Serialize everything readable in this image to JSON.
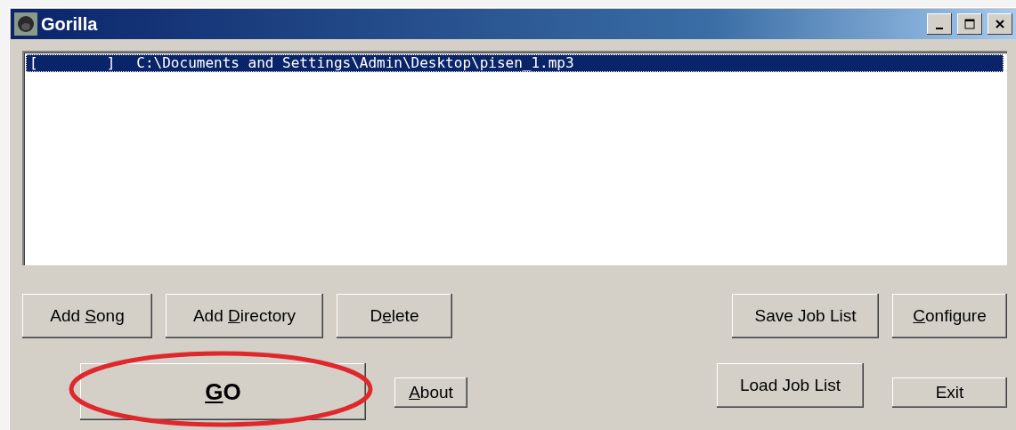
{
  "window": {
    "title": "Gorilla",
    "controls": [
      {
        "kind": "minimize"
      },
      {
        "kind": "maximize"
      },
      {
        "kind": "close"
      }
    ]
  },
  "job_list": {
    "items": [
      {
        "status": "[        ]",
        "path": "C:\\Documents and Settings\\Admin\\Desktop\\pisen_1.mp3",
        "selected": true
      }
    ]
  },
  "buttons_row_1": [
    {
      "kind": "plain",
      "before": "Add ",
      "access_key": "S",
      "after": "ong"
    },
    {
      "kind": "plain",
      "before": "Add ",
      "access_key": "D",
      "after": "irectory"
    },
    {
      "kind": "plain",
      "before": "D",
      "access_key": "e",
      "after": "lete"
    },
    {
      "kind": "spacer"
    },
    {
      "kind": "plain",
      "before": "Save Job List"
    },
    {
      "kind": "plain",
      "access_key": "C",
      "after": "onfigure"
    }
  ],
  "buttons_row_2": [
    {
      "kind": "go",
      "access_key": "G",
      "after": "O",
      "highlighted": true
    },
    {
      "kind": "small",
      "access_key": "A",
      "after": "bout"
    },
    {
      "kind": "spacer"
    },
    {
      "kind": "plain",
      "before": "Load Job List"
    },
    {
      "kind": "small",
      "before": "Exit"
    }
  ]
}
